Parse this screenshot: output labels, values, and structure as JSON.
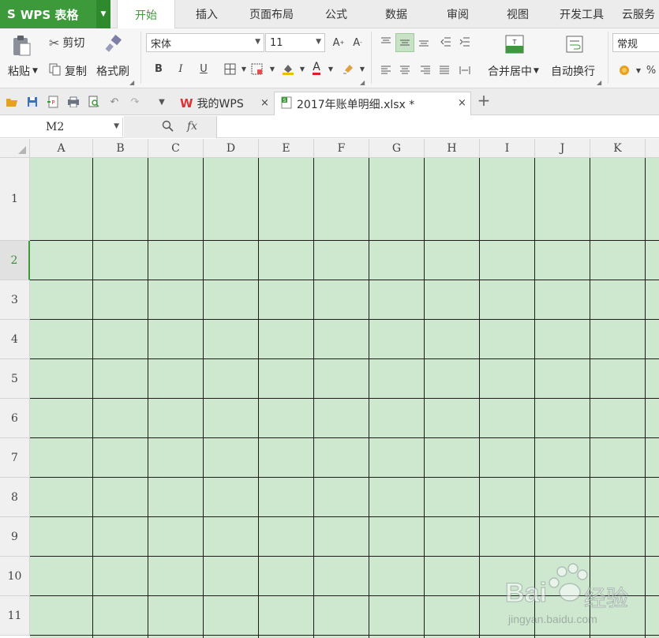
{
  "app": {
    "name": "WPS 表格",
    "logo": "S"
  },
  "menu_tabs": [
    "开始",
    "插入",
    "页面布局",
    "公式",
    "数据",
    "审阅",
    "视图",
    "开发工具",
    "云服务"
  ],
  "active_menu_tab": "开始",
  "ribbon": {
    "paste": "粘贴",
    "cut": "剪切",
    "copy": "复制",
    "format_painter": "格式刷",
    "font_name": "宋体",
    "font_size": "11",
    "bold": "B",
    "italic": "I",
    "underline": "U",
    "merge_center": "合并居中",
    "wrap_text": "自动换行",
    "number_format": "常规",
    "percent": "%"
  },
  "doc_tabs": [
    {
      "label": "我的WPS",
      "active": false
    },
    {
      "label": "2017年账单明细.xlsx *",
      "active": true
    }
  ],
  "formula_bar": {
    "cell_ref": "M2",
    "fx": "fx",
    "value": ""
  },
  "grid": {
    "columns": [
      "A",
      "B",
      "C",
      "D",
      "E",
      "F",
      "G",
      "H",
      "I",
      "J",
      "K"
    ],
    "rows": [
      "1",
      "2",
      "3",
      "4",
      "5",
      "6",
      "7",
      "8",
      "9",
      "10",
      "11"
    ],
    "selected_row": "2"
  },
  "watermark": {
    "brand": "Bai",
    "brand2": "经验",
    "url": "jingyan.baidu.com"
  },
  "colors": {
    "accent": "#3d9a3a",
    "cell_fill": "#cde8cf",
    "grid_line": "#1c1c1c"
  }
}
